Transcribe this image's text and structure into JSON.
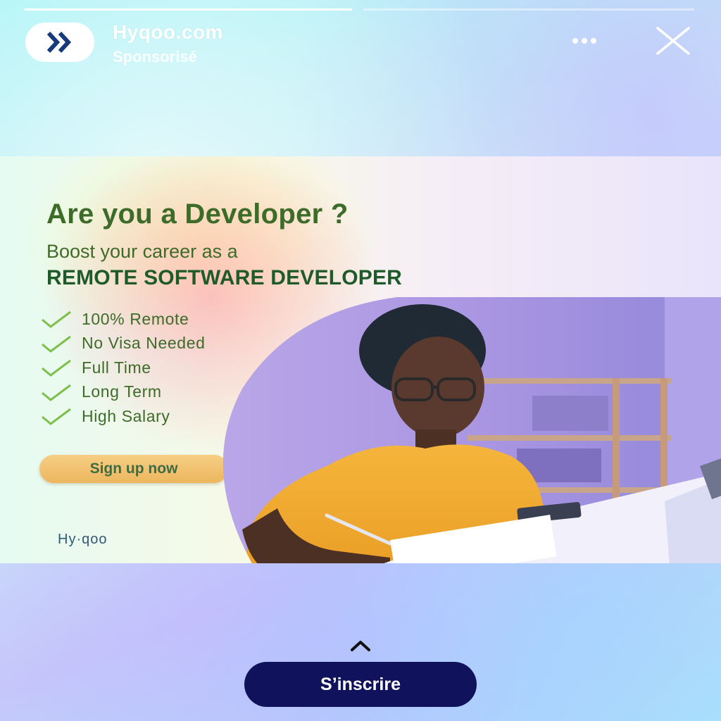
{
  "story": {
    "progress": [
      1.0,
      0.0
    ]
  },
  "header": {
    "brand_name": "Hyqoo.com",
    "sponsored_label": "Sponsorisé",
    "avatar_icon": "double-chevron-right-icon",
    "more_icon": "more-horizontal-icon",
    "close_icon": "close-icon"
  },
  "ad": {
    "headline": "Are you a Developer ?",
    "subline": "Boost your career as a",
    "tagline": "REMOTE SOFTWARE DEVELOPER",
    "features": [
      "100% Remote",
      "No Visa Needed",
      "Full Time",
      "Long Term",
      "High Salary"
    ],
    "signup_label": "Sign up now",
    "logo_text": "Hy·qoo"
  },
  "cta": {
    "label": "S’inscrire",
    "swipe_icon": "chevron-up-icon"
  },
  "colors": {
    "accent_dark": "#10125c",
    "headline_green": "#3d6b2a",
    "button_orange": "#ecb65e"
  }
}
